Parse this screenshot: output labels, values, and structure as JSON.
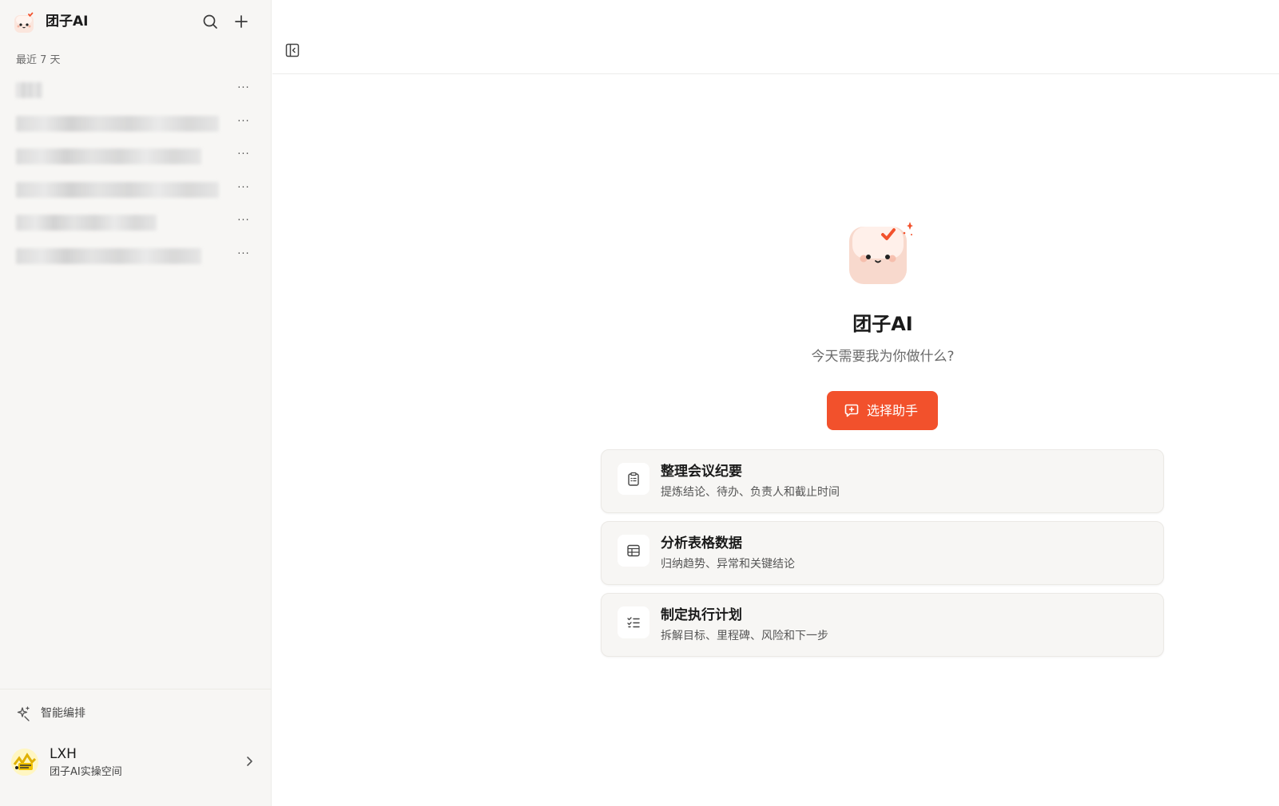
{
  "app": {
    "title": "团子AI"
  },
  "sidebar": {
    "section_label": "最近 7 天",
    "conversations": [
      {
        "title": "",
        "blur_width": 33
      },
      {
        "title": "",
        "blur_width": 254
      },
      {
        "title": "",
        "blur_width": 232
      },
      {
        "title": "",
        "blur_width": 254
      },
      {
        "title": "",
        "blur_width": 176
      },
      {
        "title": "",
        "blur_width": 232
      }
    ],
    "more_label": "···",
    "smart_arrange": "智能编排",
    "user": {
      "name": "LXH",
      "workspace": "团子AI实操空间"
    }
  },
  "main": {
    "hero_title": "团子AI",
    "hero_subtitle": "今天需要我为你做什么?",
    "primary_button": "选择助手",
    "cards": [
      {
        "title": "整理会议纪要",
        "desc": "提炼结论、待办、负责人和截止时间",
        "icon": "clipboard-icon"
      },
      {
        "title": "分析表格数据",
        "desc": "归纳趋势、异常和关键结论",
        "icon": "table-icon"
      },
      {
        "title": "制定执行计划",
        "desc": "拆解目标、里程碑、风险和下一步",
        "icon": "checklist-icon"
      }
    ]
  },
  "colors": {
    "accent": "#f2512c",
    "sidebar_bg": "#f7f6f4",
    "card_bg": "#f7f6f4"
  }
}
